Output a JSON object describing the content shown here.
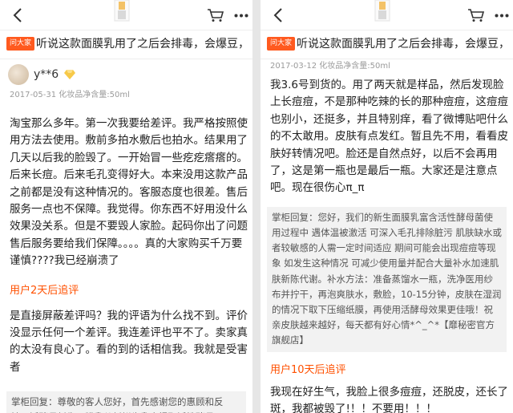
{
  "banner": {
    "tag": "问大家",
    "question": "听说这款面膜乳用了之后会排毒，会爆豆，"
  },
  "left": {
    "username": "y**6",
    "meta": "2017-05-31  化妆品净含量:50ml",
    "review": "淘宝那么多年。第一次我要给差评。我严格按照使用方法去使用。敷前多拍水敷后也拍水。结果用了几天以后我的脸毁了。一开始冒一些疙疙瘩瘩的。后来长痘。后来毛孔变得好大。本来没用这款产品之前都是没有这种情况的。客服态度也很差。售后服务一点也不保障。我觉得。你东西不好用没什么效果没关系。但是不要毁人家脸。起码你出了问题售后服务要给我们保障。。。。真的大家购买千万要谨慎????我已经崩溃了",
    "followup_title": "用户2天后追评",
    "followup": "是直接屏蔽差评吗？我的评语为什么找不到。评价没显示任何一个差评。我连差评也平不了。卖家真的太没有良心了。看的到的话相信我。我就是受害者",
    "reply": "掌柜回复：尊敬的客人您好，首先感谢您的惠顾和反馈！活酵母新生面膜乳从新鲜牛乳中提取活性酵母"
  },
  "right": {
    "meta": "2017-03-12  化妆品净含量:50ml",
    "review": "我3.6号到货的。用了两天就是样品，然后发现脸上长痘痘，不是那种吃辣的长的那种痘痘，这痘痘也别小，还挺多，并且特别痒，看了微博贴吧什么的不太敢用。皮肤有点发红。暂且先不用，看看皮肤好转情况吧。脸还是自然点好，以后不会再用了，这是第一瓶也是最后一瓶。大家还是注意点吧。现在很伤心π_π",
    "reply": "掌柜回复：您好，我们的新生面膜乳富含活性酵母菌使用过程中 遇体温被激活 可深入毛孔排除脏污 肌肤缺水或者较敏感的人需一定时间适应 期间可能会出现痘痘等现象 如发生这种情况 可减少使用量并配合大量补水加速肌肤新陈代谢。补水方法：准备蒸馏水一瓶，洗净医用纱布并拧干，再泡爽肤水，敷脸，10-15分钟，皮肤在湿润的情况下取下压缩纸膜，再使用活酵母效果更佳哦！祝亲皮肤越来越好，每天都有好心情*^_^*【靡秘密官方旗舰店】",
    "followup_title": "用户10天后追评",
    "followup": "我现在好生气，我脸上很多痘痘，还脱皮，还长了斑，我都被毁了!！！不要用！！！"
  },
  "icons": [
    "back-icon",
    "cart-icon",
    "more-icon",
    "diamond-icon"
  ],
  "colors": {
    "accent": "#ff5000",
    "tag": "#ff5a1f",
    "reply_bg": "#f2f2f2"
  }
}
